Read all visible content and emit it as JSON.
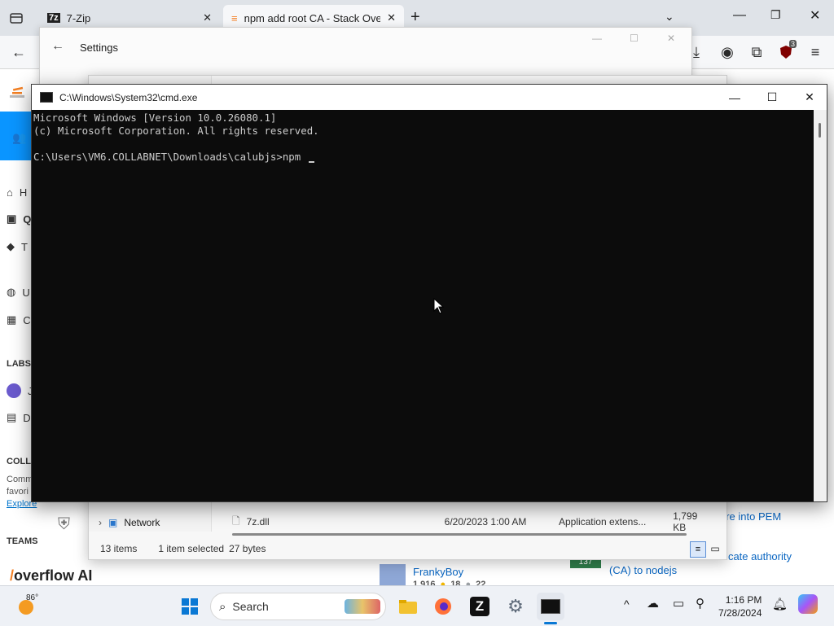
{
  "browser": {
    "tabs": [
      {
        "title": "7-Zip",
        "active": false
      },
      {
        "title": "npm add root CA - Stack Overf",
        "active": true
      }
    ],
    "extension_badge": "3"
  },
  "settings_window": {
    "title": "Settings"
  },
  "stackoverflow": {
    "nav_items": [
      "H",
      "Q",
      "T",
      "U",
      "C"
    ],
    "labs_header": "LABS",
    "labs_items": [
      "J",
      "D"
    ],
    "collectives_header": "COLLE",
    "collectives_text_1": "Comm",
    "collectives_text_2": "favori",
    "collectives_link": "Explore",
    "teams_header": "TEAMS",
    "teams_logo_text": "overflow AI",
    "related_question": {
      "votes": "137",
      "title": "How to add custom certificate authority (CA) to nodejs"
    },
    "related_snippet": "are into PEM",
    "user": {
      "name": "FrankyBoy",
      "rep": "1,916",
      "gold": "18",
      "silver": "22"
    }
  },
  "explorer": {
    "sidebar_item": "Network",
    "file_rows": [
      {
        "name": "7z.dll",
        "date": "6/20/2023 1:00 AM",
        "type": "Application extens...",
        "size": "1,799 KB"
      }
    ],
    "status_items": "13 items",
    "status_selected": "1 item selected",
    "status_bytes": "27 bytes"
  },
  "cmd": {
    "title": "C:\\Windows\\System32\\cmd.exe",
    "lines": [
      "Microsoft Windows [Version 10.0.26080.1]",
      "(c) Microsoft Corporation. All rights reserved.",
      "",
      "C:\\Users\\VM6.COLLABNET\\Downloads\\calubjs>npm "
    ]
  },
  "taskbar": {
    "weather": "86°",
    "search_placeholder": "Search",
    "time": "1:16 PM",
    "date": "7/28/2024"
  },
  "colors": {
    "so_orange": "#f48024",
    "so_blue": "#0a95ff",
    "cmd_bg": "#0c0c0c"
  }
}
